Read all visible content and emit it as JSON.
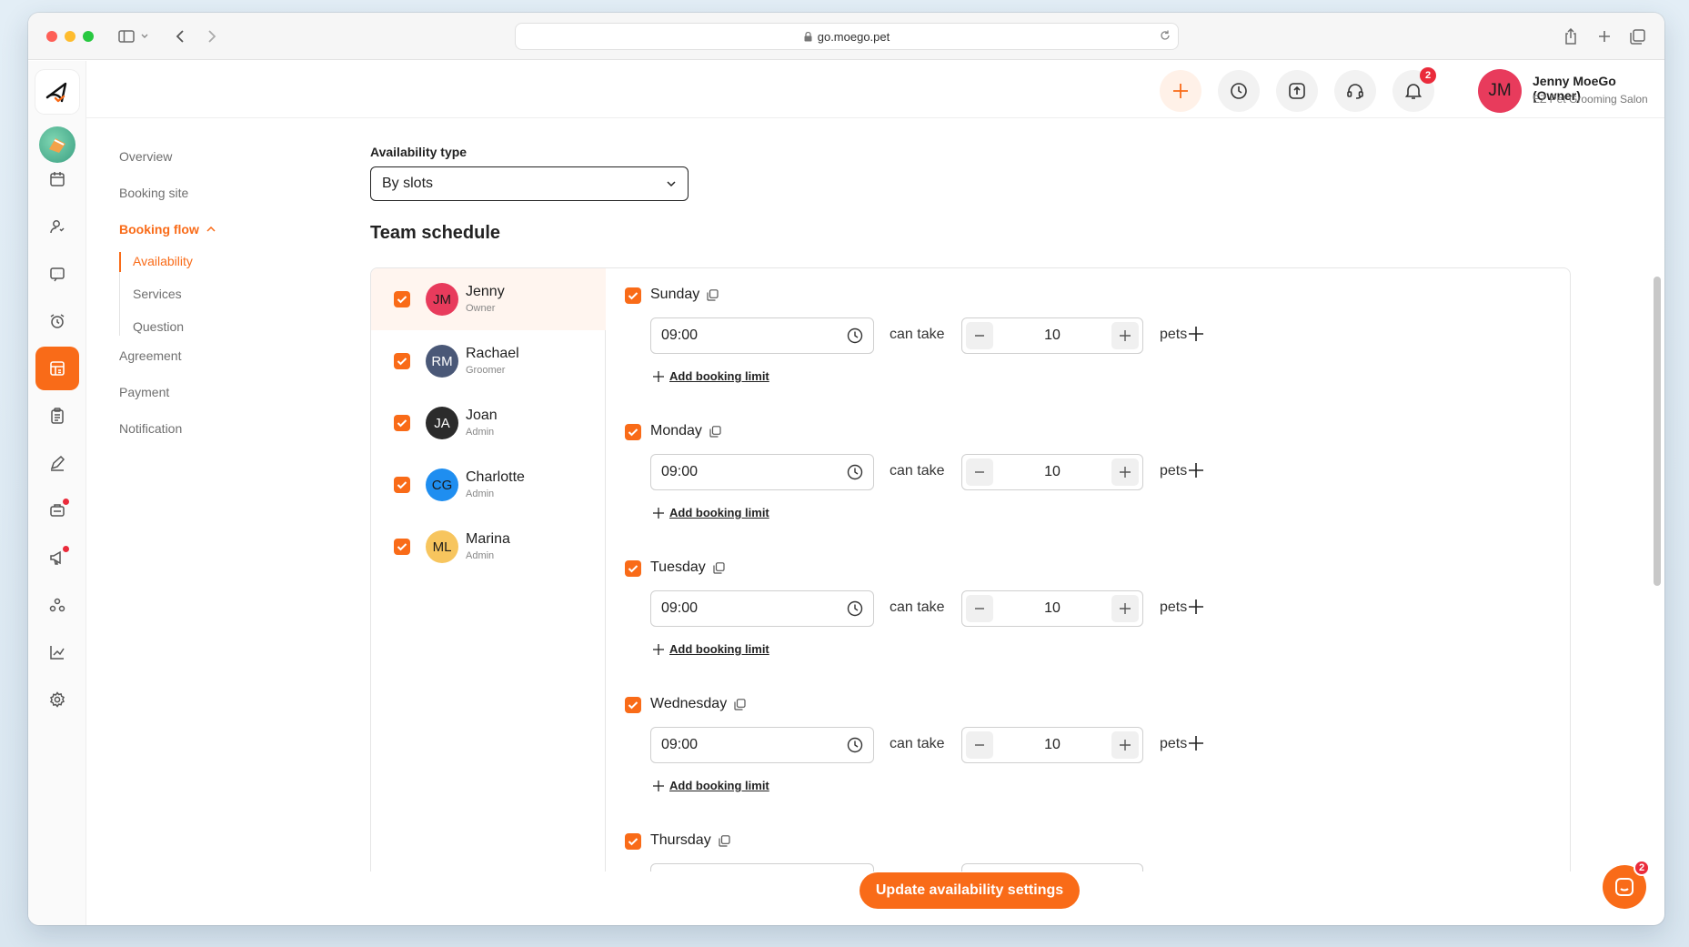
{
  "browser": {
    "url": "go.moego.pet"
  },
  "header": {
    "user_initials": "JM",
    "user_name": "Jenny MoeGo (Owner)",
    "business_name": "EZ Pet Grooming Salon",
    "notification_count": "2"
  },
  "subnav": {
    "overview": "Overview",
    "booking_site": "Booking site",
    "booking_flow": "Booking flow",
    "availability": "Availability",
    "services": "Services",
    "question": "Question",
    "agreement": "Agreement",
    "payment": "Payment",
    "notification": "Notification"
  },
  "main": {
    "availability_type_label": "Availability type",
    "availability_type_value": "By slots",
    "team_schedule_title": "Team schedule"
  },
  "staff": [
    {
      "initials": "JM",
      "name": "Jenny",
      "role": "Owner",
      "color": "#e83b5c"
    },
    {
      "initials": "RM",
      "name": "Rachael",
      "role": "Groomer",
      "color": "#4a5877"
    },
    {
      "initials": "JA",
      "name": "Joan",
      "role": "Admin",
      "color": "#2b2b2b"
    },
    {
      "initials": "CG",
      "name": "Charlotte",
      "role": "Admin",
      "color": "#1f8ef0"
    },
    {
      "initials": "ML",
      "name": "Marina",
      "role": "Admin",
      "color": "#f7c55e"
    }
  ],
  "schedule": {
    "can_take_label": "can take",
    "pets_label": "pets",
    "add_limit_label": "Add booking limit",
    "days": [
      {
        "name": "Sunday",
        "time": "09:00",
        "capacity": "10"
      },
      {
        "name": "Monday",
        "time": "09:00",
        "capacity": "10"
      },
      {
        "name": "Tuesday",
        "time": "09:00",
        "capacity": "10"
      },
      {
        "name": "Wednesday",
        "time": "09:00",
        "capacity": "10"
      },
      {
        "name": "Thursday"
      }
    ]
  },
  "footer": {
    "update_button": "Update availability settings",
    "chat_badge": "2"
  },
  "colors": {
    "accent": "#f96b18",
    "badge": "#ea2b3b"
  }
}
